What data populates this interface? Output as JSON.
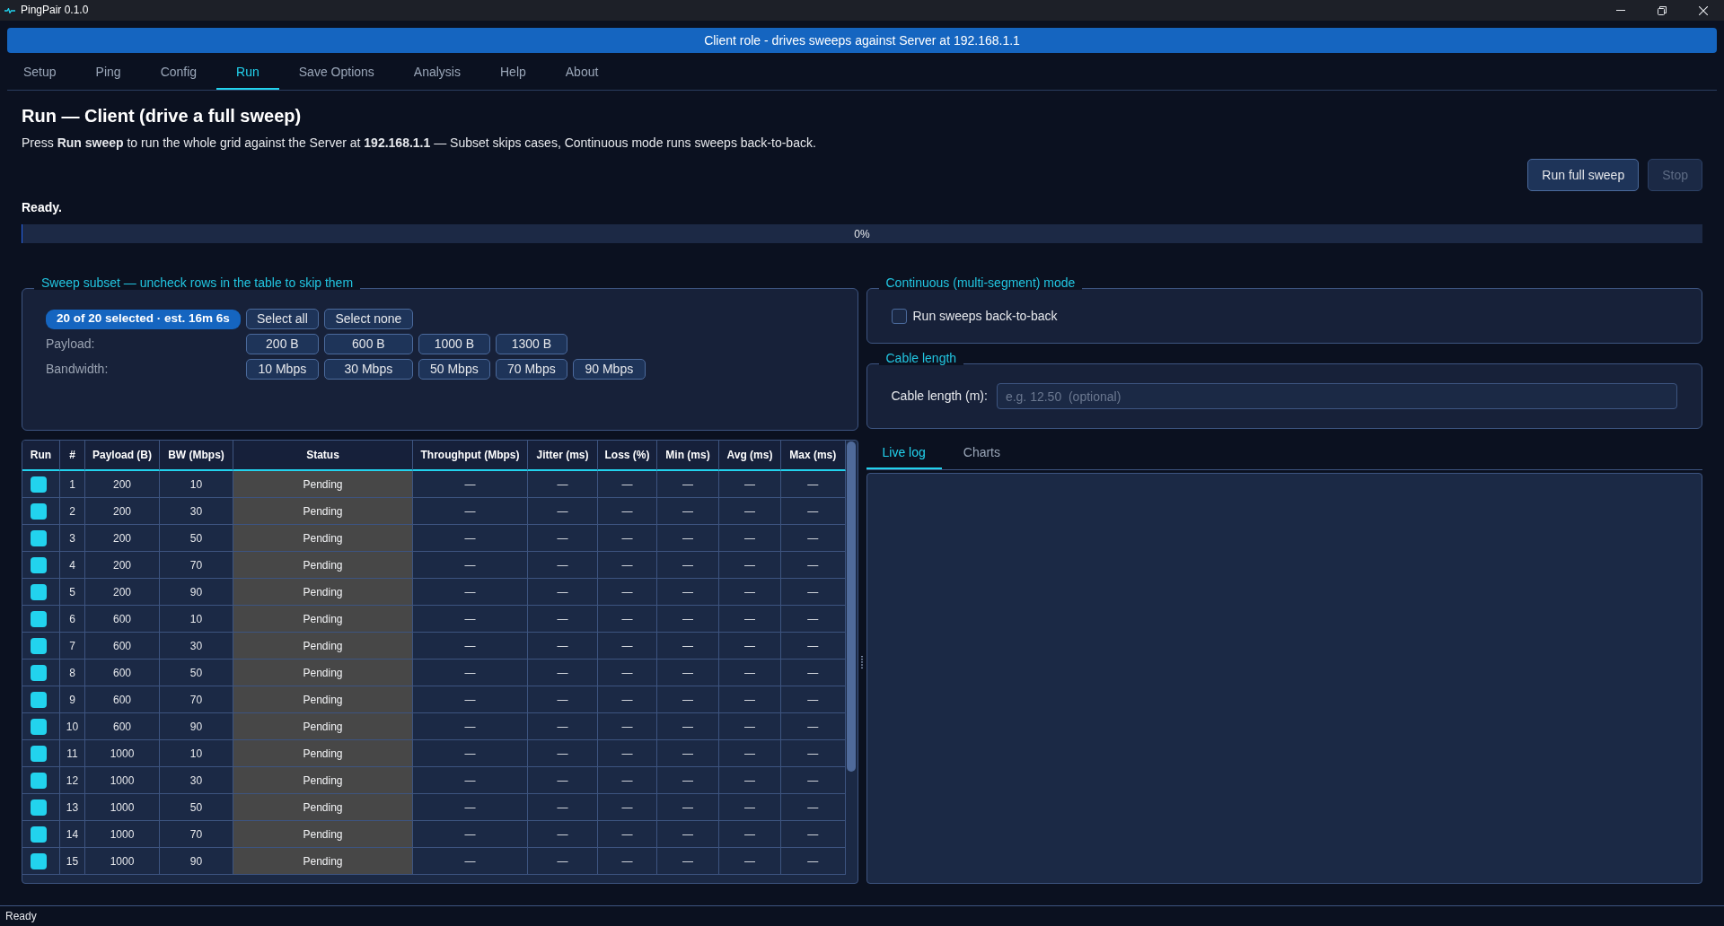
{
  "window": {
    "title": "PingPair 0.1.0"
  },
  "banner": "Client role - drives sweeps against Server at 192.168.1.1",
  "tabs": [
    {
      "label": "Setup",
      "selected": false
    },
    {
      "label": "Ping",
      "selected": false
    },
    {
      "label": "Config",
      "selected": false
    },
    {
      "label": "Run",
      "selected": true
    },
    {
      "label": "Save Options",
      "selected": false
    },
    {
      "label": "Analysis",
      "selected": false
    },
    {
      "label": "Help",
      "selected": false
    },
    {
      "label": "About",
      "selected": false
    }
  ],
  "page": {
    "heading": "Run — Client (drive a full sweep)",
    "description": "Press **Run sweep** to run the whole grid against the Server at **192.168.1.1** — Subset skips cases, Continuous mode runs sweeps back-to-back.",
    "buttons": [
      {
        "label": "Run full sweep",
        "disabled": false
      },
      {
        "label": "Stop",
        "disabled": true
      }
    ],
    "status": "Ready.",
    "progress": {
      "level": 0,
      "reading": "0%"
    }
  },
  "subset": {
    "title": "Sweep subset — uncheck rows in the table to skip them",
    "summary": "20 of 20 selected · est. 16m 6s",
    "actions": [
      "Select all",
      "Select none"
    ],
    "filters": [
      {
        "label": "Payload:",
        "options": [
          "200 B",
          "600 B",
          "1000 B",
          "1300 B"
        ]
      },
      {
        "label": "Bandwidth:",
        "options": [
          "10 Mbps",
          "30 Mbps",
          "50 Mbps",
          "70 Mbps",
          "90 Mbps"
        ]
      }
    ]
  },
  "table": {
    "columns": [
      "Run",
      "#",
      "Payload (B)",
      "BW (Mbps)",
      "Status",
      "Throughput (Mbps)",
      "Jitter (ms)",
      "Loss (%)",
      "Min (ms)",
      "Avg (ms)",
      "Max (ms)"
    ],
    "rows": [
      {
        "run": true,
        "number": "1",
        "payload": "200",
        "bw": "10",
        "status": "Pending",
        "throughput": "—",
        "jitter": "—",
        "loss": "—",
        "min": "—",
        "avg": "—",
        "max": "—"
      },
      {
        "run": true,
        "number": "2",
        "payload": "200",
        "bw": "30",
        "status": "Pending",
        "throughput": "—",
        "jitter": "—",
        "loss": "—",
        "min": "—",
        "avg": "—",
        "max": "—"
      },
      {
        "run": true,
        "number": "3",
        "payload": "200",
        "bw": "50",
        "status": "Pending",
        "throughput": "—",
        "jitter": "—",
        "loss": "—",
        "min": "—",
        "avg": "—",
        "max": "—"
      },
      {
        "run": true,
        "number": "4",
        "payload": "200",
        "bw": "70",
        "status": "Pending",
        "throughput": "—",
        "jitter": "—",
        "loss": "—",
        "min": "—",
        "avg": "—",
        "max": "—"
      },
      {
        "run": true,
        "number": "5",
        "payload": "200",
        "bw": "90",
        "status": "Pending",
        "throughput": "—",
        "jitter": "—",
        "loss": "—",
        "min": "—",
        "avg": "—",
        "max": "—"
      },
      {
        "run": true,
        "number": "6",
        "payload": "600",
        "bw": "10",
        "status": "Pending",
        "throughput": "—",
        "jitter": "—",
        "loss": "—",
        "min": "—",
        "avg": "—",
        "max": "—"
      },
      {
        "run": true,
        "number": "7",
        "payload": "600",
        "bw": "30",
        "status": "Pending",
        "throughput": "—",
        "jitter": "—",
        "loss": "—",
        "min": "—",
        "avg": "—",
        "max": "—"
      },
      {
        "run": true,
        "number": "8",
        "payload": "600",
        "bw": "50",
        "status": "Pending",
        "throughput": "—",
        "jitter": "—",
        "loss": "—",
        "min": "—",
        "avg": "—",
        "max": "—"
      },
      {
        "run": true,
        "number": "9",
        "payload": "600",
        "bw": "70",
        "status": "Pending",
        "throughput": "—",
        "jitter": "—",
        "loss": "—",
        "min": "—",
        "avg": "—",
        "max": "—"
      },
      {
        "run": true,
        "number": "10",
        "payload": "600",
        "bw": "90",
        "status": "Pending",
        "throughput": "—",
        "jitter": "—",
        "loss": "—",
        "min": "—",
        "avg": "—",
        "max": "—"
      },
      {
        "run": true,
        "number": "11",
        "payload": "1000",
        "bw": "10",
        "status": "Pending",
        "throughput": "—",
        "jitter": "—",
        "loss": "—",
        "min": "—",
        "avg": "—",
        "max": "—"
      },
      {
        "run": true,
        "number": "12",
        "payload": "1000",
        "bw": "30",
        "status": "Pending",
        "throughput": "—",
        "jitter": "—",
        "loss": "—",
        "min": "—",
        "avg": "—",
        "max": "—"
      },
      {
        "run": true,
        "number": "13",
        "payload": "1000",
        "bw": "50",
        "status": "Pending",
        "throughput": "—",
        "jitter": "—",
        "loss": "—",
        "min": "—",
        "avg": "—",
        "max": "—"
      },
      {
        "run": true,
        "number": "14",
        "payload": "1000",
        "bw": "70",
        "status": "Pending",
        "throughput": "—",
        "jitter": "—",
        "loss": "—",
        "min": "—",
        "avg": "—",
        "max": "—"
      },
      {
        "run": true,
        "number": "15",
        "payload": "1000",
        "bw": "90",
        "status": "Pending",
        "throughput": "—",
        "jitter": "—",
        "loss": "—",
        "min": "—",
        "avg": "—",
        "max": "—"
      }
    ]
  },
  "continuous": {
    "title": "Continuous (multi-segment) mode",
    "checkbox": {
      "label": "Run sweeps back-to-back",
      "checked": false
    }
  },
  "cable": {
    "title": "Cable length",
    "label": "Cable length (m):",
    "placeholder": "e.g. 12.50  (optional)"
  },
  "output_tabs": [
    {
      "label": "Live log",
      "selected": true
    },
    {
      "label": "Charts",
      "selected": false
    }
  ],
  "status_bar": "Ready"
}
